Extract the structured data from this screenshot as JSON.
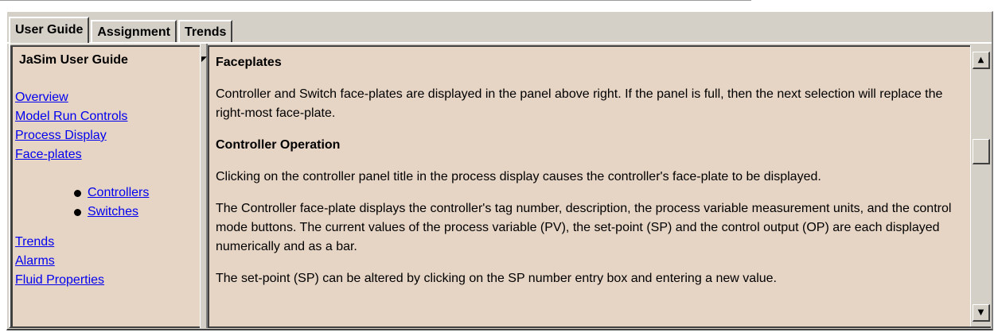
{
  "tabs": [
    {
      "label": "User Guide"
    },
    {
      "label": "Assignment"
    },
    {
      "label": "Trends"
    }
  ],
  "left": {
    "title": "JaSim User Guide",
    "nav_main": [
      "Overview",
      "Model Run Controls",
      "Process Display",
      "Face-plates"
    ],
    "nav_sub": [
      "Controllers",
      "Switches"
    ],
    "nav_more": [
      "Trends",
      "Alarms",
      "Fluid Properties"
    ]
  },
  "doc": {
    "h1": "Faceplates",
    "p1": "Controller and Switch face-plates are displayed in the panel above right. If the panel is full, then the next selection will replace the right-most face-plate.",
    "h2": "Controller Operation",
    "p2": "Clicking on the controller panel title in the process display causes the controller's face-plate to be displayed.",
    "p3": "The Controller face-plate displays the controller's tag number, description, the process variable measurement units, and the control mode buttons. The current values of the process variable (PV), the set-point (SP) and the control output (OP) are each displayed numerically and as a bar.",
    "p4": "The set-point (SP) can be altered by clicking on the SP number entry box and entering a new value."
  },
  "icons": {
    "scroll_up": "scroll-up-arrow-icon",
    "scroll_down": "scroll-down-arrow-icon",
    "bullet": "bullet-icon"
  },
  "colors": {
    "pane_bg": "#e6d4c4",
    "chrome": "#d4d0c8",
    "link": "#0000ee"
  }
}
